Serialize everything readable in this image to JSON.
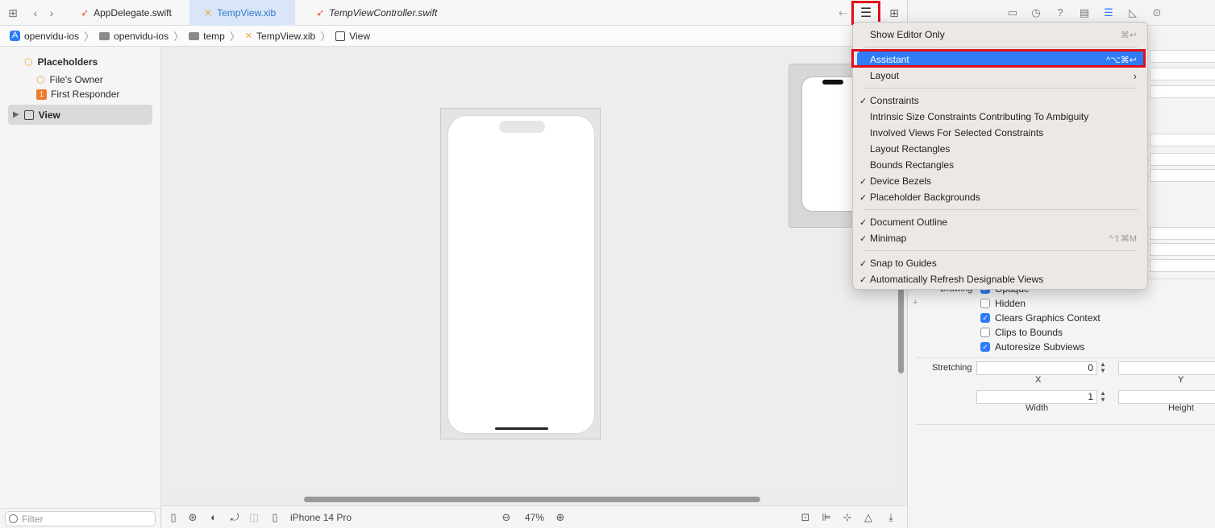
{
  "tabs": [
    {
      "label": "AppDelegate.swift",
      "kind": "swift",
      "active": false
    },
    {
      "label": "TempView.xib",
      "kind": "xib",
      "active": true
    },
    {
      "label": "TempViewController.swift",
      "kind": "swift",
      "active": false
    }
  ],
  "breadcrumb": [
    "openvidu-ios",
    "openvidu-ios",
    "temp",
    "TempView.xib",
    "View"
  ],
  "outline": {
    "placeholders_label": "Placeholders",
    "files_owner": "File's Owner",
    "first_responder": "First Responder",
    "first_responder_badge": "1",
    "view_label": "View"
  },
  "filter": {
    "placeholder": "Filter"
  },
  "canvas_bottom": {
    "device": "iPhone 14 Pro",
    "zoom": "47%"
  },
  "menu": {
    "items": [
      {
        "label": "Show Editor Only",
        "checked": false,
        "shortcut": "⌘↩"
      },
      {
        "label": "Assistant",
        "checked": false,
        "shortcut": "^⌥⌘↩",
        "highlighted": true
      },
      {
        "label": "Layout",
        "checked": false,
        "submenu": true
      },
      {
        "label": "Constraints",
        "checked": true
      },
      {
        "label": "Intrinsic Size Constraints Contributing To Ambiguity",
        "checked": false
      },
      {
        "label": "Involved Views For Selected Constraints",
        "checked": false
      },
      {
        "label": "Layout Rectangles",
        "checked": false
      },
      {
        "label": "Bounds Rectangles",
        "checked": false
      },
      {
        "label": "Device Bezels",
        "checked": true
      },
      {
        "label": "Placeholder Backgrounds",
        "checked": true
      },
      {
        "label": "Document Outline",
        "checked": true
      },
      {
        "label": "Minimap",
        "checked": true,
        "shortcut": "^⇧⌘M"
      },
      {
        "label": "Snap to Guides",
        "checked": true
      },
      {
        "label": "Automatically Refresh Designable Views",
        "checked": true
      }
    ]
  },
  "inspector": {
    "drawing_label": "Drawing",
    "opaque_label": "Opaque",
    "checkboxes": [
      {
        "label": "Hidden",
        "checked": false
      },
      {
        "label": "Clears Graphics Context",
        "checked": true
      },
      {
        "label": "Clips to Bounds",
        "checked": false
      },
      {
        "label": "Autoresize Subviews",
        "checked": true
      }
    ],
    "stretching_label": "Stretching",
    "stretch_x": "0",
    "stretch_width": "1",
    "x_label": "X",
    "y_label": "Y",
    "width_label": "Width",
    "height_label": "Height"
  },
  "colors": {
    "accent": "#2f7bf5",
    "highlight_box": "#e10d1d"
  }
}
